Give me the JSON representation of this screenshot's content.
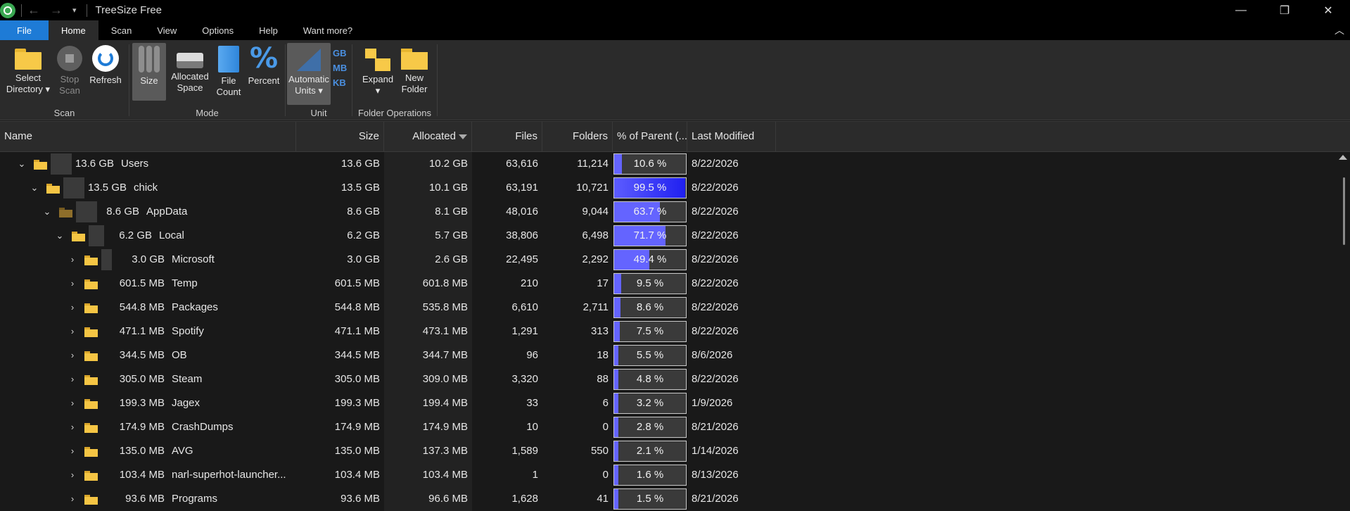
{
  "titlebar": {
    "title": "TreeSize Free",
    "back": "←",
    "forward": "→",
    "quick": "▾",
    "minimize": "—",
    "restore": "❐",
    "close": "✕"
  },
  "tabs": {
    "file": "File",
    "home": "Home",
    "scan": "Scan",
    "view": "View",
    "options": "Options",
    "help": "Help",
    "more": "Want more?",
    "collapse": "︿"
  },
  "ribbon": {
    "scan_group": {
      "label": "Scan",
      "select_line1": "Select",
      "select_line2": "Directory ▾",
      "stop_line1": "Stop",
      "stop_line2": "Scan",
      "refresh": "Refresh"
    },
    "mode_group": {
      "label": "Mode",
      "size": "Size",
      "alloc_line1": "Allocated",
      "alloc_line2": "Space",
      "count_line1": "File",
      "count_line2": "Count",
      "percent": "Percent",
      "percent_symbol": "%"
    },
    "unit_group": {
      "label": "Unit",
      "auto_line1": "Automatic",
      "auto_line2": "Units ▾",
      "gb": "GB",
      "mb": "MB",
      "kb": "KB"
    },
    "folder_group": {
      "label": "Folder Operations",
      "expand": "Expand",
      "expand_arrow": "▾",
      "new_line1": "New",
      "new_line2": "Folder"
    }
  },
  "columns": {
    "name": "Name",
    "size": "Size",
    "allocated": "Allocated",
    "files": "Files",
    "folders": "Folders",
    "pct": "% of Parent (...",
    "modified": "Last Modified"
  },
  "rows": [
    {
      "chev": "⌄",
      "name_size": "13.6 GB",
      "name": "Users",
      "size": "13.6 GB",
      "allocated": "10.2 GB",
      "files": "63,616",
      "folders": "11,214",
      "pct": 10.6,
      "pct_label": "10.6 %",
      "modified": "8/22/2026",
      "depth": 0,
      "bar": 1.0,
      "dark": false
    },
    {
      "chev": "⌄",
      "name_size": "13.5 GB",
      "name": "chick",
      "size": "13.5 GB",
      "allocated": "10.1 GB",
      "files": "63,191",
      "folders": "10,721",
      "pct": 99.5,
      "pct_label": "99.5 %",
      "modified": "8/22/2026",
      "depth": 1,
      "bar": 1.0,
      "dark": false
    },
    {
      "chev": "⌄",
      "name_size": "8.6 GB",
      "name": "AppData",
      "size": "8.6 GB",
      "allocated": "8.1 GB",
      "files": "48,016",
      "folders": "9,044",
      "pct": 63.7,
      "pct_label": "63.7 %",
      "modified": "8/22/2026",
      "depth": 2,
      "bar": 1.0,
      "dark": true
    },
    {
      "chev": "⌄",
      "name_size": "6.2 GB",
      "name": "Local",
      "size": "6.2 GB",
      "allocated": "5.7 GB",
      "files": "38,806",
      "folders": "6,498",
      "pct": 71.7,
      "pct_label": "71.7 %",
      "modified": "8/22/2026",
      "depth": 3,
      "bar": 0.72,
      "dark": false
    },
    {
      "chev": "›",
      "name_size": "3.0 GB",
      "name": "Microsoft",
      "size": "3.0 GB",
      "allocated": "2.6 GB",
      "files": "22,495",
      "folders": "2,292",
      "pct": 49.4,
      "pct_label": "49.4 %",
      "modified": "8/22/2026",
      "depth": 4,
      "bar": 0.49,
      "dark": false
    },
    {
      "chev": "›",
      "name_size": "601.5 MB",
      "name": "Temp",
      "size": "601.5 MB",
      "allocated": "601.8 MB",
      "files": "210",
      "folders": "17",
      "pct": 9.5,
      "pct_label": "9.5 %",
      "modified": "8/22/2026",
      "depth": 4,
      "bar": 0.0,
      "dark": false
    },
    {
      "chev": "›",
      "name_size": "544.8 MB",
      "name": "Packages",
      "size": "544.8 MB",
      "allocated": "535.8 MB",
      "files": "6,610",
      "folders": "2,711",
      "pct": 8.6,
      "pct_label": "8.6 %",
      "modified": "8/22/2026",
      "depth": 4,
      "bar": 0.0,
      "dark": false
    },
    {
      "chev": "›",
      "name_size": "471.1 MB",
      "name": "Spotify",
      "size": "471.1 MB",
      "allocated": "473.1 MB",
      "files": "1,291",
      "folders": "313",
      "pct": 7.5,
      "pct_label": "7.5 %",
      "modified": "8/22/2026",
      "depth": 4,
      "bar": 0.0,
      "dark": false
    },
    {
      "chev": "›",
      "name_size": "344.5 MB",
      "name": "OB",
      "size": "344.5 MB",
      "allocated": "344.7 MB",
      "files": "96",
      "folders": "18",
      "pct": 5.5,
      "pct_label": "5.5 %",
      "modified": "8/6/2026",
      "depth": 4,
      "bar": 0.0,
      "dark": false
    },
    {
      "chev": "›",
      "name_size": "305.0 MB",
      "name": "Steam",
      "size": "305.0 MB",
      "allocated": "309.0 MB",
      "files": "3,320",
      "folders": "88",
      "pct": 4.8,
      "pct_label": "4.8 %",
      "modified": "8/22/2026",
      "depth": 4,
      "bar": 0.0,
      "dark": false
    },
    {
      "chev": "›",
      "name_size": "199.3 MB",
      "name": "Jagex",
      "size": "199.3 MB",
      "allocated": "199.4 MB",
      "files": "33",
      "folders": "6",
      "pct": 3.2,
      "pct_label": "3.2 %",
      "modified": "1/9/2026",
      "depth": 4,
      "bar": 0.0,
      "dark": false
    },
    {
      "chev": "›",
      "name_size": "174.9 MB",
      "name": "CrashDumps",
      "size": "174.9 MB",
      "allocated": "174.9 MB",
      "files": "10",
      "folders": "0",
      "pct": 2.8,
      "pct_label": "2.8 %",
      "modified": "8/21/2026",
      "depth": 4,
      "bar": 0.0,
      "dark": false
    },
    {
      "chev": "›",
      "name_size": "135.0 MB",
      "name": "AVG",
      "size": "135.0 MB",
      "allocated": "137.3 MB",
      "files": "1,589",
      "folders": "550",
      "pct": 2.1,
      "pct_label": "2.1 %",
      "modified": "1/14/2026",
      "depth": 4,
      "bar": 0.0,
      "dark": false
    },
    {
      "chev": "›",
      "name_size": "103.4 MB",
      "name": "narl-superhot-launcher...",
      "size": "103.4 MB",
      "allocated": "103.4 MB",
      "files": "1",
      "folders": "0",
      "pct": 1.6,
      "pct_label": "1.6 %",
      "modified": "8/13/2026",
      "depth": 4,
      "bar": 0.0,
      "dark": false
    },
    {
      "chev": "›",
      "name_size": "93.6 MB",
      "name": "Programs",
      "size": "93.6 MB",
      "allocated": "96.6 MB",
      "files": "1,628",
      "folders": "41",
      "pct": 1.5,
      "pct_label": "1.5 %",
      "modified": "8/21/2026",
      "depth": 4,
      "bar": 0.0,
      "dark": false
    }
  ]
}
